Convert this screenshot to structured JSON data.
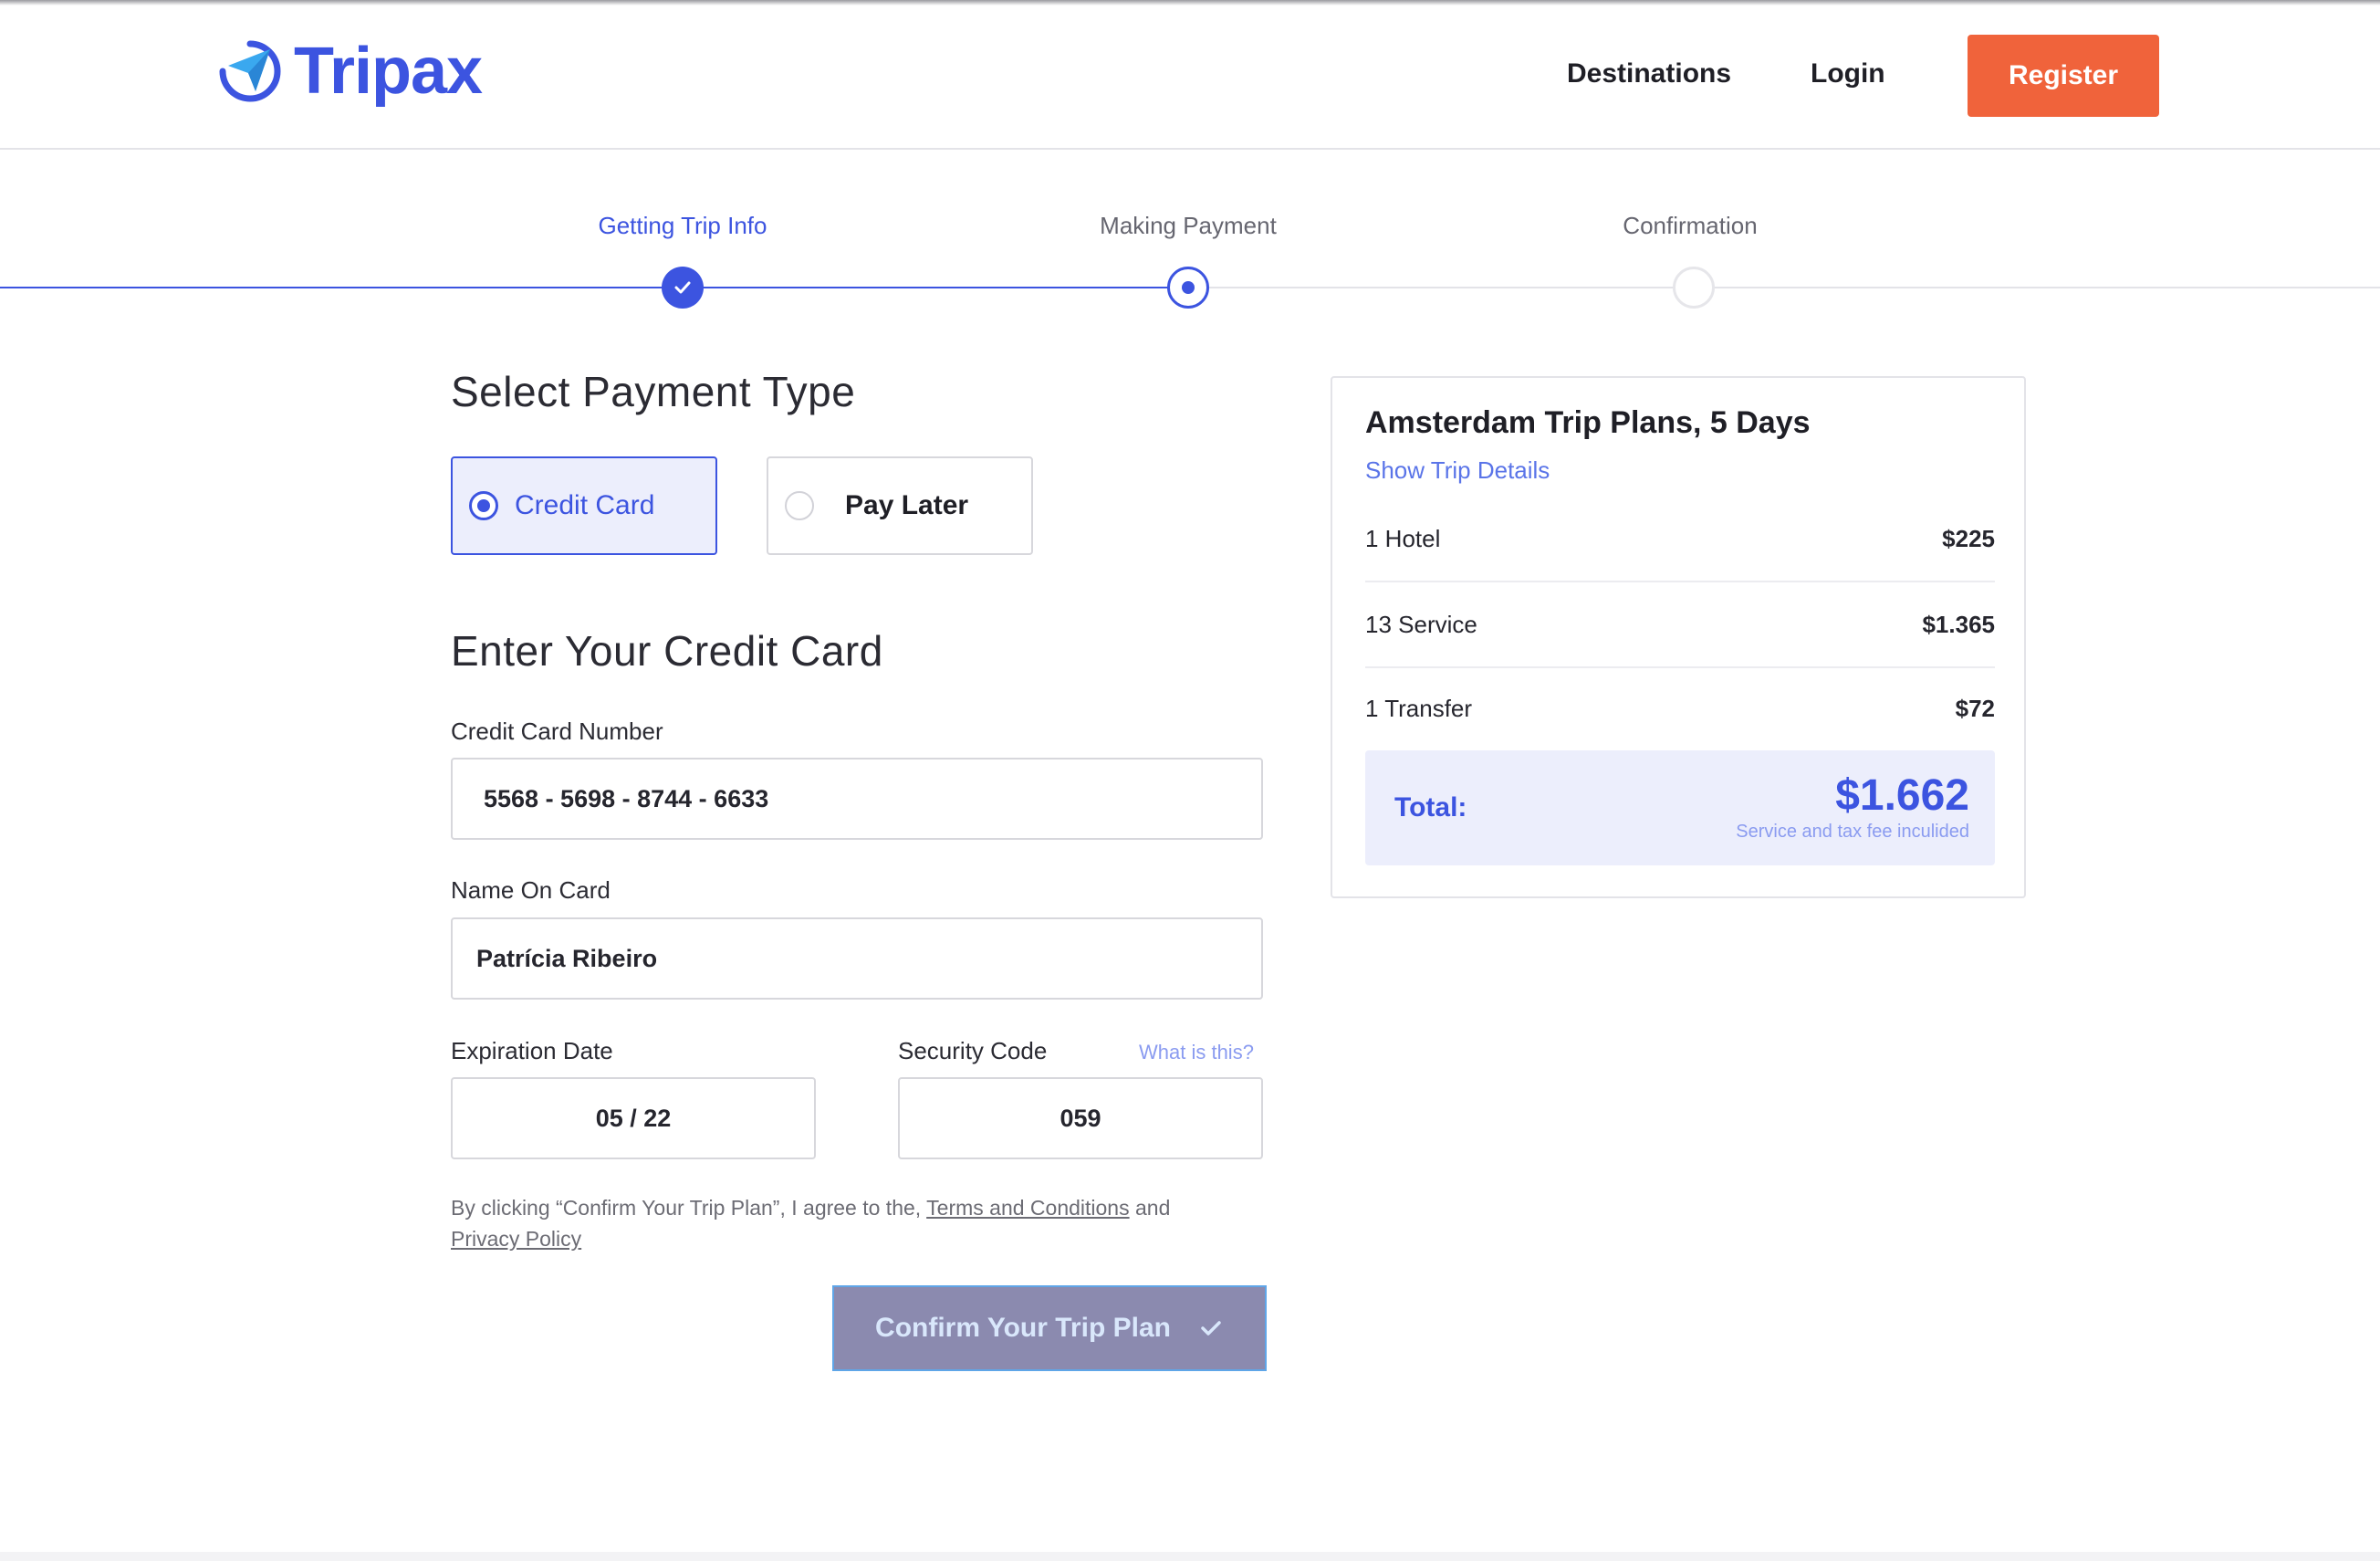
{
  "header": {
    "brand": "Tripax",
    "nav": {
      "destinations": "Destinations",
      "login": "Login",
      "register": "Register"
    }
  },
  "stepper": {
    "steps": [
      {
        "label": "Getting Trip Info",
        "state": "done"
      },
      {
        "label": "Making Payment",
        "state": "current"
      },
      {
        "label": "Confirmation",
        "state": "todo"
      }
    ]
  },
  "payment": {
    "title": "Select Payment Type",
    "options": [
      {
        "label": "Credit Card",
        "selected": true
      },
      {
        "label": "Pay Later",
        "selected": false
      }
    ]
  },
  "card_form": {
    "title": "Enter Your Credit Card",
    "number_label": "Credit Card Number",
    "number_value": "5568 - 5698 - 8744 - 6633",
    "name_label": "Name On Card",
    "name_value": "Patrícia Ribeiro",
    "expiry_label": "Expiration Date",
    "expiry_value": "05 / 22",
    "cvc_label": "Security Code",
    "cvc_value": "059",
    "cvc_help": "What is this?",
    "legal_prefix": "By clicking “Confirm Your Trip Plan”, I agree to the, ",
    "terms": "Terms and Conditions",
    "legal_and": " and",
    "privacy": "Privacy Policy",
    "confirm_label": "Confirm Your Trip Plan"
  },
  "summary": {
    "title": "Amsterdam Trip Plans, 5 Days",
    "details_link": "Show Trip Details",
    "items": [
      {
        "label": "1 Hotel",
        "price": "$225"
      },
      {
        "label": "13 Service",
        "price": "$1.365"
      },
      {
        "label": "1 Transfer",
        "price": "$72"
      }
    ],
    "total_label": "Total:",
    "total_amount": "$1.662",
    "total_note": "Service and tax fee inculided"
  },
  "colors": {
    "accent": "#3c54e0",
    "register": "#f0633b",
    "confirm_bg": "#8b8aaf"
  }
}
